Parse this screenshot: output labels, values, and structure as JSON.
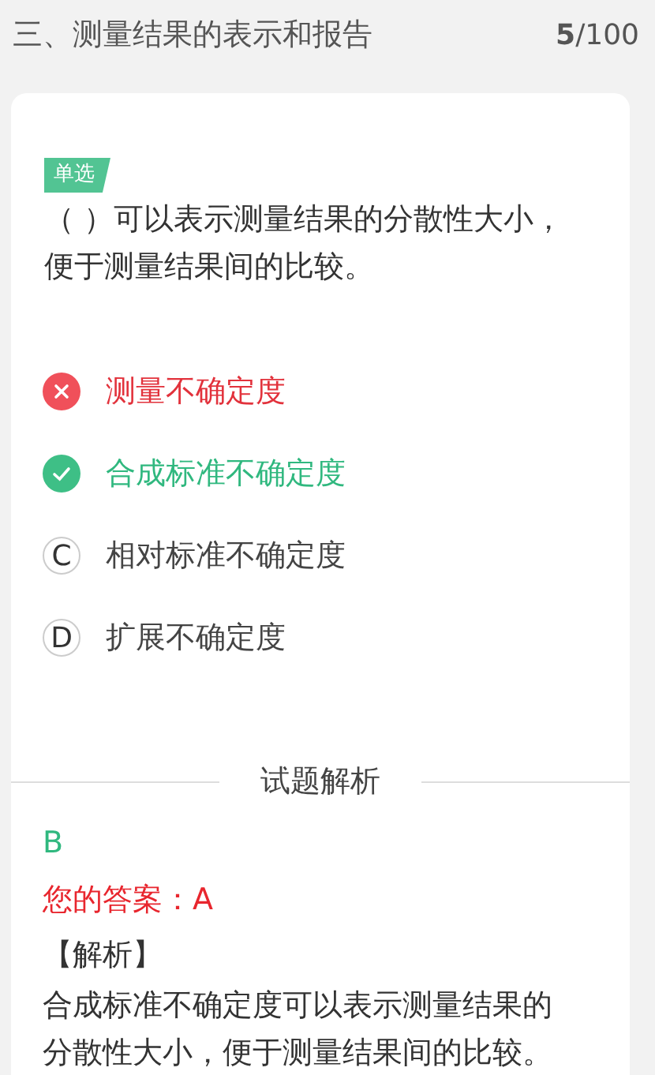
{
  "header": {
    "title": "三、测量结果的表示和报告",
    "progress": "**5**/100"
  },
  "question": {
    "type_tag": "单选",
    "text": "（ ）可以表示测量结果的分散性大小，便于测量结果间的比较。"
  },
  "options": [
    {
      "kind": "wrong",
      "text": "测量不确定度"
    },
    {
      "kind": "correct",
      "text": "合成标准不确定度"
    },
    {
      "kind": "plain",
      "letter": "C",
      "text": "相对标准不确定度"
    },
    {
      "kind": "plain",
      "letter": "D",
      "text": "扩展不确定度"
    }
  ],
  "analysis": {
    "heading": "试题解析",
    "correct_answer": "B",
    "your_answer": "您的答案：A",
    "label": "【解析】",
    "text": "合成标准不确定度可以表示测量结果的分散性大小，便于测量结果间的比较。"
  }
}
